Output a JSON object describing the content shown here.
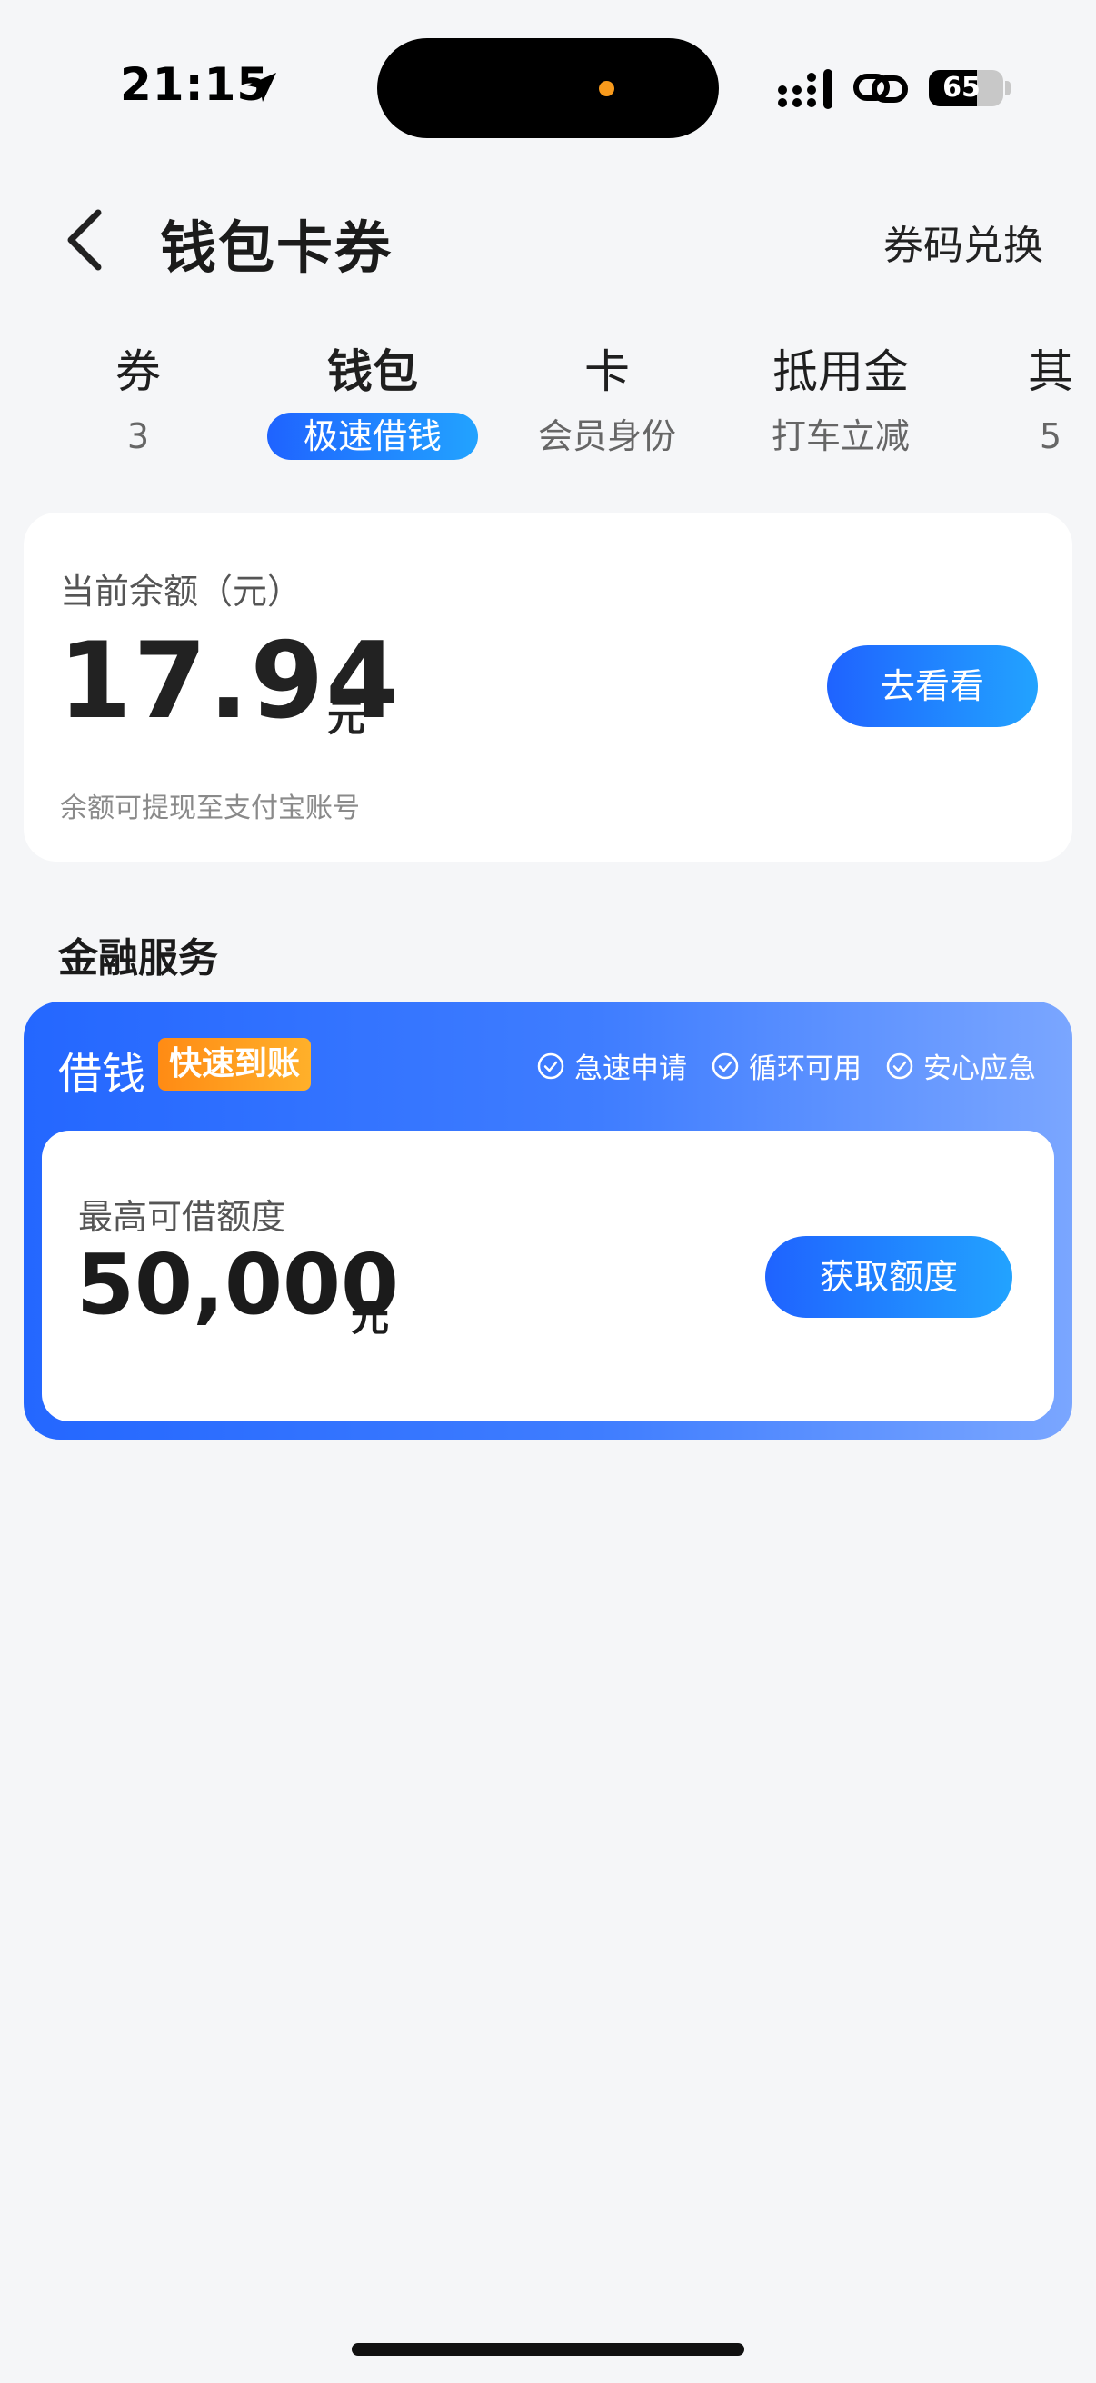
{
  "status_bar": {
    "time": "21:15",
    "battery": "65",
    "battery_level": 0.65
  },
  "header": {
    "title": "钱包卡券",
    "action_label": "券码兑换"
  },
  "tabs": [
    {
      "label": "券",
      "sub": "3",
      "active": false
    },
    {
      "label": "钱包",
      "sub": "极速借钱",
      "active": true
    },
    {
      "label": "卡",
      "sub": "会员身份",
      "active": false
    },
    {
      "label": "抵用金",
      "sub": "打车立减",
      "active": false
    },
    {
      "label": "其",
      "sub": "5",
      "active": false
    }
  ],
  "balance": {
    "title": "当前余额（元）",
    "amount": "17.94",
    "unit": "元",
    "button_label": "去看看",
    "note": "余额可提现至支付宝账号"
  },
  "finance": {
    "section_title": "金融服务",
    "loan": {
      "title": "借钱",
      "badge": "快速到账",
      "features": [
        "急速申请",
        "循环可用",
        "安心应急"
      ],
      "limit_label": "最高可借额度",
      "amount": "50,000",
      "unit": "元",
      "button_label": "获取额度"
    }
  },
  "colors": {
    "primary_blue": "#1f63ff",
    "accent_orange": "#ff8b14"
  }
}
